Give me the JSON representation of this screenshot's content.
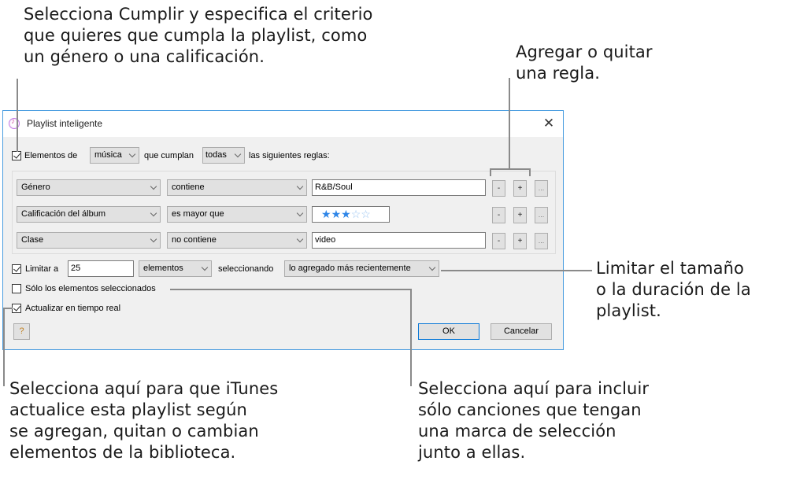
{
  "callouts": {
    "top_left": "Selecciona Cumplir y especifica el criterio\nque quieres que cumpla la playlist, como\nun género o una calificación.",
    "top_right": "Agregar o quitar\nuna regla.",
    "right": "Limitar el tamaño\no la duración de la\nplaylist.",
    "bottom_left": "Selecciona aquí para que iTunes\nactualice esta playlist según\nse agregan, quitan o cambian\nelementos de la biblioteca.",
    "bottom_right": "Selecciona aquí para incluir\nsólo canciones que tengan\nuna marca de selección\njunto a ellas."
  },
  "dialog": {
    "title": "Playlist inteligente",
    "close_icon": "close-icon",
    "match": {
      "checked": true,
      "label_prefix": "Elementos de",
      "media_value": "música",
      "label_middle": "que cumplan",
      "match_value": "todas",
      "label_suffix": "las siguientes reglas:"
    },
    "rules": [
      {
        "field": "Género",
        "operator": "contiene",
        "value": "R&B/Soul",
        "type": "text"
      },
      {
        "field": "Calificación del álbum",
        "operator": "es mayor que",
        "rating": 3,
        "rating_max": 5,
        "type": "rating"
      },
      {
        "field": "Clase",
        "operator": "no contiene",
        "value": "video",
        "type": "text"
      }
    ],
    "rule_buttons": {
      "remove": "-",
      "add": "+",
      "more": "..."
    },
    "limit": {
      "checked": true,
      "label": "Limitar a",
      "value": "25",
      "unit": "elementos",
      "selecting_label": "seleccionando",
      "selecting_value": "lo agregado más recientemente"
    },
    "only_checked": {
      "checked": false,
      "label": "Sólo los elementos seleccionados"
    },
    "live_update": {
      "checked": true,
      "label": "Actualizar en tiempo real"
    },
    "buttons": {
      "help": "?",
      "ok": "OK",
      "cancel": "Cancelar"
    }
  }
}
